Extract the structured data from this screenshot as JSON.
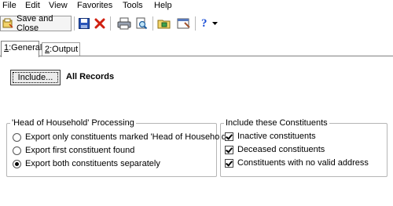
{
  "menu": [
    "File",
    "Edit",
    "View",
    "Favorites",
    "Tools",
    "Help"
  ],
  "toolbar": {
    "save_close_label": "Save and Close",
    "icons": [
      "save-close-icon",
      "save-icon",
      "delete-icon",
      "print-icon",
      "print-preview-icon",
      "open-icon",
      "properties-icon",
      "help-icon",
      "dropdown-arrow-icon"
    ],
    "help_glyph": "?",
    "colors": {
      "help_blue": "#1c4fd6",
      "delete_red": "#d02010"
    }
  },
  "tabs": [
    {
      "key": "1",
      "label": ":General",
      "active": true
    },
    {
      "key": "2",
      "label": ":Output",
      "active": false
    }
  ],
  "general": {
    "include_button": "Include...",
    "include_value": "All Records",
    "hoh": {
      "legend": "'Head of Household' Processing",
      "options": [
        {
          "label": "Export only constituents marked 'Head of Household'",
          "selected": false
        },
        {
          "label": "Export first constituent found",
          "selected": false
        },
        {
          "label": "Export both constituents separately",
          "selected": true
        }
      ]
    },
    "include_constituents": {
      "legend": "Include these Constituents",
      "options": [
        {
          "label": "Inactive constituents",
          "checked": true
        },
        {
          "label": "Deceased constituents",
          "checked": true
        },
        {
          "label": "Constituents with no valid address",
          "checked": true
        }
      ]
    }
  }
}
